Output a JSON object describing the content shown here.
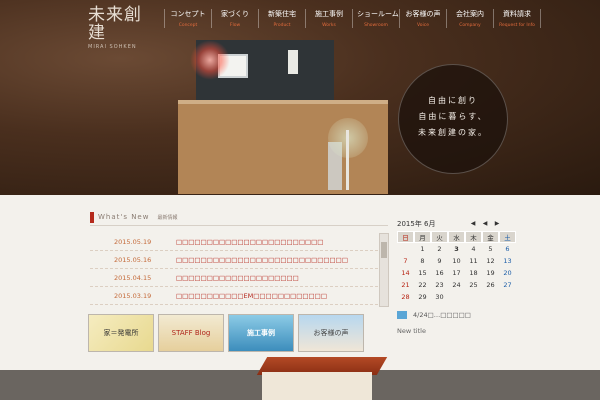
{
  "logo": {
    "mark": "未来創建",
    "sub": "MIRAI SOHKEN"
  },
  "nav": [
    {
      "jp": "コンセプト",
      "en": "Concept"
    },
    {
      "jp": "家づくり",
      "en": "Flow"
    },
    {
      "jp": "新築住宅",
      "en": "Product"
    },
    {
      "jp": "施工事例",
      "en": "Works"
    },
    {
      "jp": "ショールーム",
      "en": "Showroom"
    },
    {
      "jp": "お客様の声",
      "en": "Voice"
    },
    {
      "jp": "会社案内",
      "en": "Company"
    },
    {
      "jp": "資料請求",
      "en": "Request for Info"
    }
  ],
  "hero": {
    "lines": [
      "自由に創り",
      "自由に暮らす、",
      "未来創建の家。"
    ]
  },
  "news": {
    "title_en": "What's New",
    "title_jp": "最新情報",
    "items": [
      {
        "date": "2015.05.19",
        "title": "□□□□□□□□□□□□□□□□□□□□□□□□"
      },
      {
        "date": "2015.05.16",
        "title": "□□□□□□□□□□□□□□□□□□□□□□□□□□□□"
      },
      {
        "date": "2015.04.15",
        "title": "□□□□□□□□□□□□□□□□□□□□"
      },
      {
        "date": "2015.03.19",
        "title": "□□□□□□□□□□□EM□□□□□□□□□□□□"
      }
    ]
  },
  "banners": [
    {
      "label": "家＝発電所"
    },
    {
      "label": "STAFF Blog"
    },
    {
      "label": "施工事例"
    },
    {
      "label": "お客様の声"
    }
  ],
  "calendar": {
    "month_label": "2015年 6月",
    "nav": [
      "◀",
      "◀",
      "▶"
    ],
    "dow": [
      "日",
      "月",
      "火",
      "水",
      "木",
      "金",
      "土"
    ],
    "weeks": [
      [
        "",
        "1",
        "2",
        "3",
        "4",
        "5",
        "6"
      ],
      [
        "7",
        "8",
        "9",
        "10",
        "11",
        "12",
        "13"
      ],
      [
        "14",
        "15",
        "16",
        "17",
        "18",
        "19",
        "20"
      ],
      [
        "21",
        "22",
        "23",
        "24",
        "25",
        "26",
        "27"
      ],
      [
        "28",
        "29",
        "30",
        "",
        "",
        "",
        ""
      ]
    ],
    "event": "4/24□…□□□□□",
    "new_title": "New title"
  },
  "colors": {
    "accent": "#b52a1c",
    "nav_en": "#e26b3c",
    "event": "#5aa6d6"
  }
}
